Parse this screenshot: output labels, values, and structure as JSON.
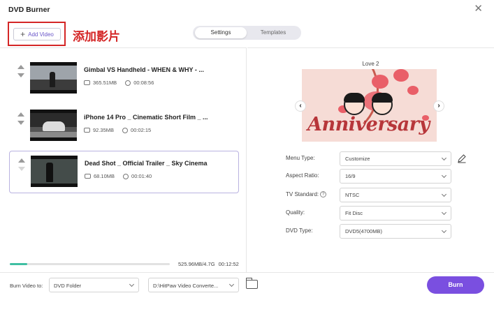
{
  "window": {
    "title": "DVD Burner"
  },
  "toolbar": {
    "add_video_label": "Add Video",
    "annotation": "添加影片"
  },
  "tabs": [
    {
      "label": "Settings",
      "active": true
    },
    {
      "label": "Templates",
      "active": false
    }
  ],
  "videos": [
    {
      "title": "Gimbal VS Handheld - WHEN & WHY - ...",
      "size": "365.51MB",
      "duration": "00:08:56",
      "selected": false
    },
    {
      "title": "iPhone 14 Pro _ Cinematic Short Film _ ...",
      "size": "92.35MB",
      "duration": "00:02:15",
      "selected": false
    },
    {
      "title": "Dead Shot _ Official Trailer _ Sky Cinema",
      "size": "68.10MB",
      "duration": "00:01:40",
      "selected": true
    }
  ],
  "storage": {
    "used_fraction": 0.11,
    "text": "525.96MB/4.7G",
    "total_duration": "00:12:52"
  },
  "preview": {
    "template_name": "Love 2",
    "banner_text": "Anniversary"
  },
  "settings": {
    "menu_type": {
      "label": "Menu Type:",
      "value": "Customize"
    },
    "aspect_ratio": {
      "label": "Aspect Ratio:",
      "value": "16/9"
    },
    "tv_standard": {
      "label": "TV Standard:",
      "value": "NTSC"
    },
    "quality": {
      "label": "Quality:",
      "value": "Fit Disc"
    },
    "dvd_type": {
      "label": "DVD Type:",
      "value": "DVD5(4700MB)"
    }
  },
  "bottom": {
    "burn_to_label": "Burn Video to:",
    "burn_target": "DVD Folder",
    "output_path": "D:\\HitPaw Video Converte...",
    "burn_label": "Burn"
  },
  "colors": {
    "accent": "#7a4fe0",
    "progress": "#3fbfa2",
    "annotation": "#d42626"
  }
}
